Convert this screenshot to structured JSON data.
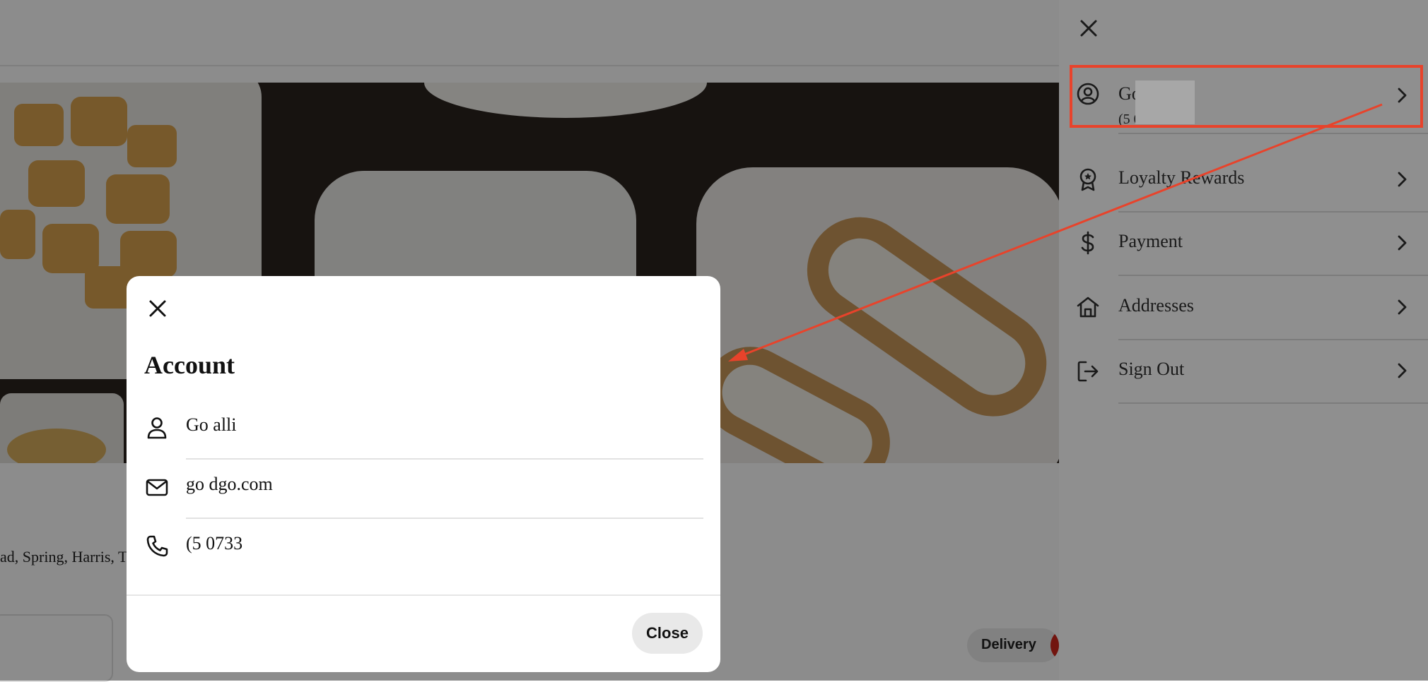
{
  "background": {
    "address_fragment": "ad, Spring, Harris, T",
    "delivery_label": "Delivery"
  },
  "drawer": {
    "profile": {
      "name": "Go      alli",
      "phone": "(5        0733"
    },
    "items": [
      {
        "label": "Loyalty Rewards",
        "icon": "award-icon"
      },
      {
        "label": "Payment",
        "icon": "dollar-icon"
      },
      {
        "label": "Addresses",
        "icon": "home-icon"
      },
      {
        "label": "Sign Out",
        "icon": "sign-out-icon"
      }
    ]
  },
  "modal": {
    "title": "Account",
    "name": "Go        alli",
    "email": "go                    dgo.com",
    "phone": "(5          0733",
    "close_button": "Close"
  },
  "colors": {
    "annotation": "#e8432b",
    "overlay": "rgba(0,0,0,0.45)",
    "delivery_accent": "#d0271d"
  }
}
